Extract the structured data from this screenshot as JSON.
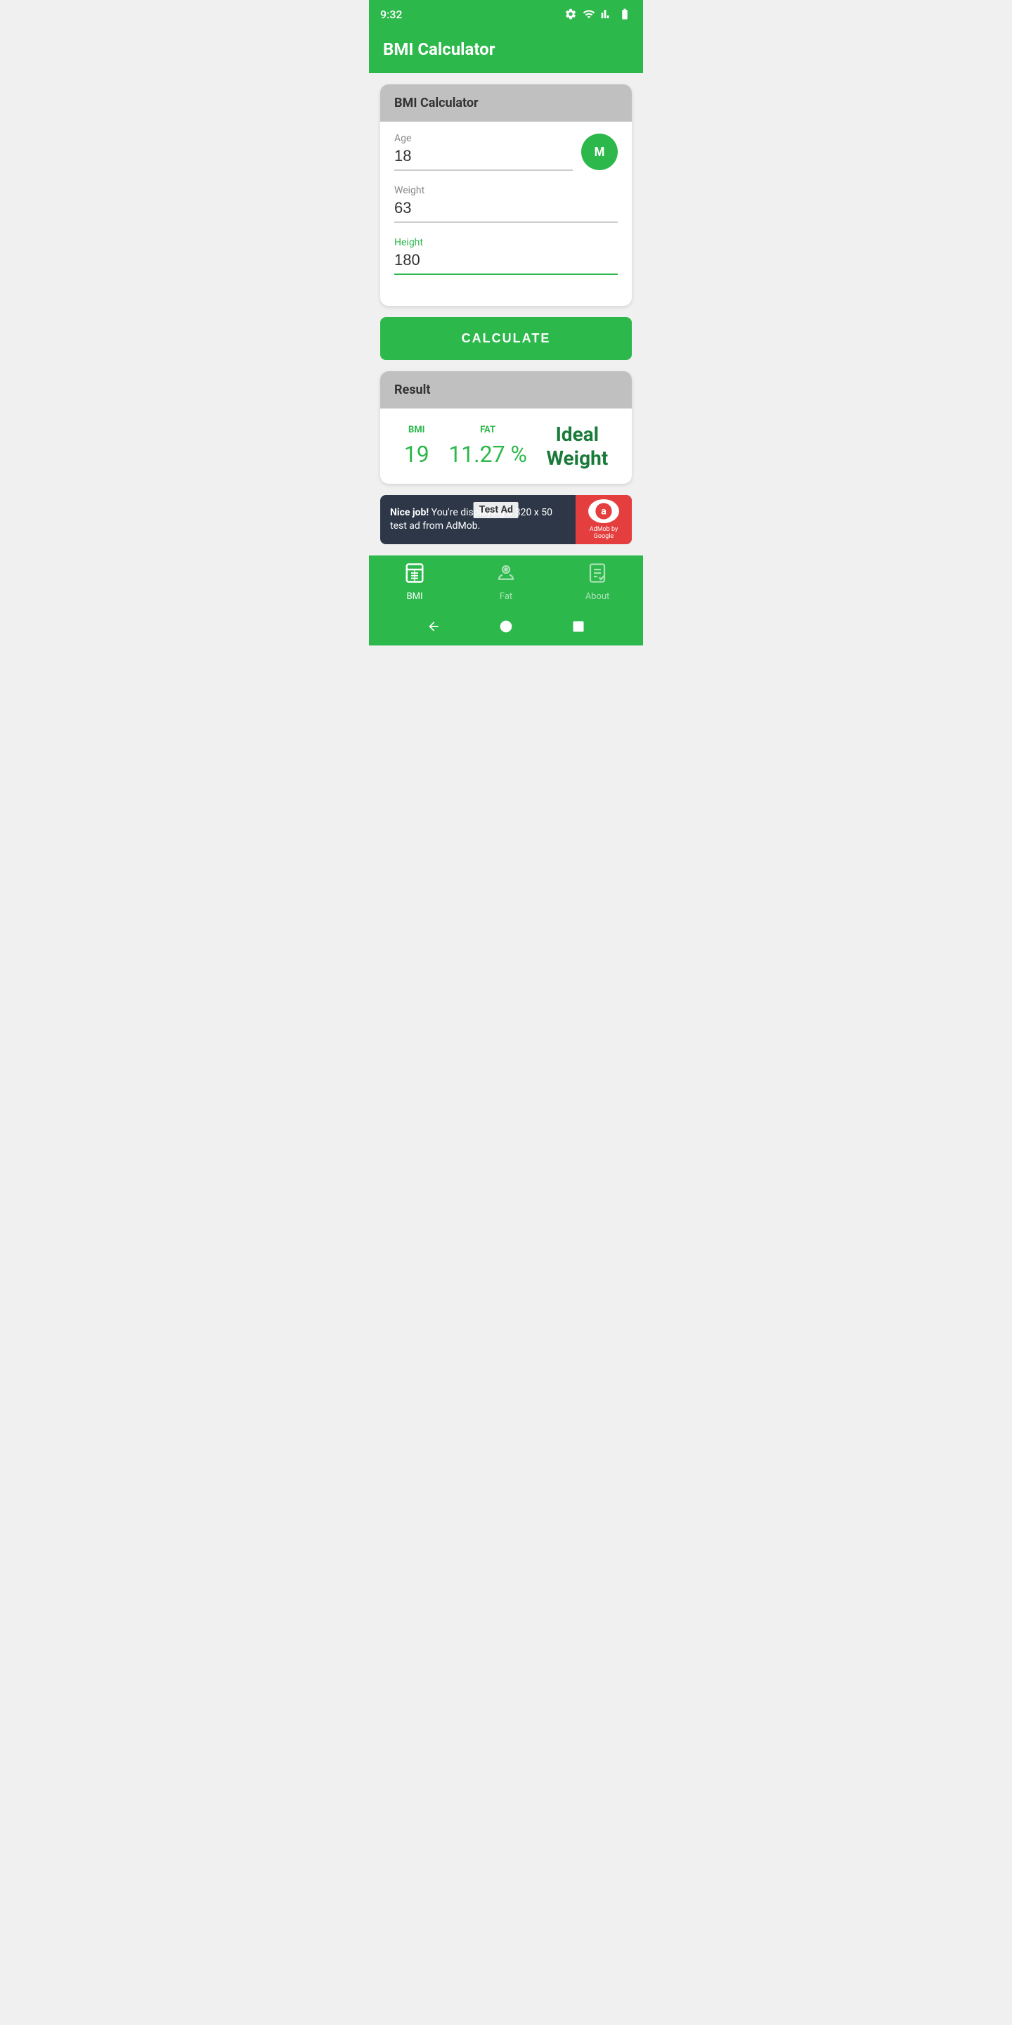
{
  "statusBar": {
    "time": "9:32",
    "icons": [
      "settings",
      "wifi",
      "signal",
      "battery"
    ]
  },
  "appBar": {
    "title": "BMI Calculator"
  },
  "bmiCard": {
    "header": "BMI Calculator",
    "ageLabel": "Age",
    "ageValue": "18",
    "genderBtn": "M",
    "weightLabel": "Weight",
    "weightValue": "63",
    "heightLabel": "Height",
    "heightValue": "180"
  },
  "calculateBtn": "CALCULATE",
  "resultCard": {
    "header": "Result",
    "bmiLabel": "BMI",
    "bmiValue": "19",
    "fatLabel": "FAT",
    "fatValue": "11.27 %",
    "statusText": "Ideal\nWeight"
  },
  "adBanner": {
    "boldText": "Nice job!",
    "normalText": " You're displaying a 320 x 50 test ad from AdMob.",
    "testLabel": "Test Ad",
    "logoText": "AdMob by Google"
  },
  "bottomNav": {
    "items": [
      {
        "id": "bmi",
        "label": "BMI",
        "active": true
      },
      {
        "id": "fat",
        "label": "Fat",
        "active": false
      },
      {
        "id": "about",
        "label": "About",
        "active": false
      }
    ]
  },
  "sysNav": {
    "back": "◀",
    "home": "●",
    "recent": "■"
  }
}
